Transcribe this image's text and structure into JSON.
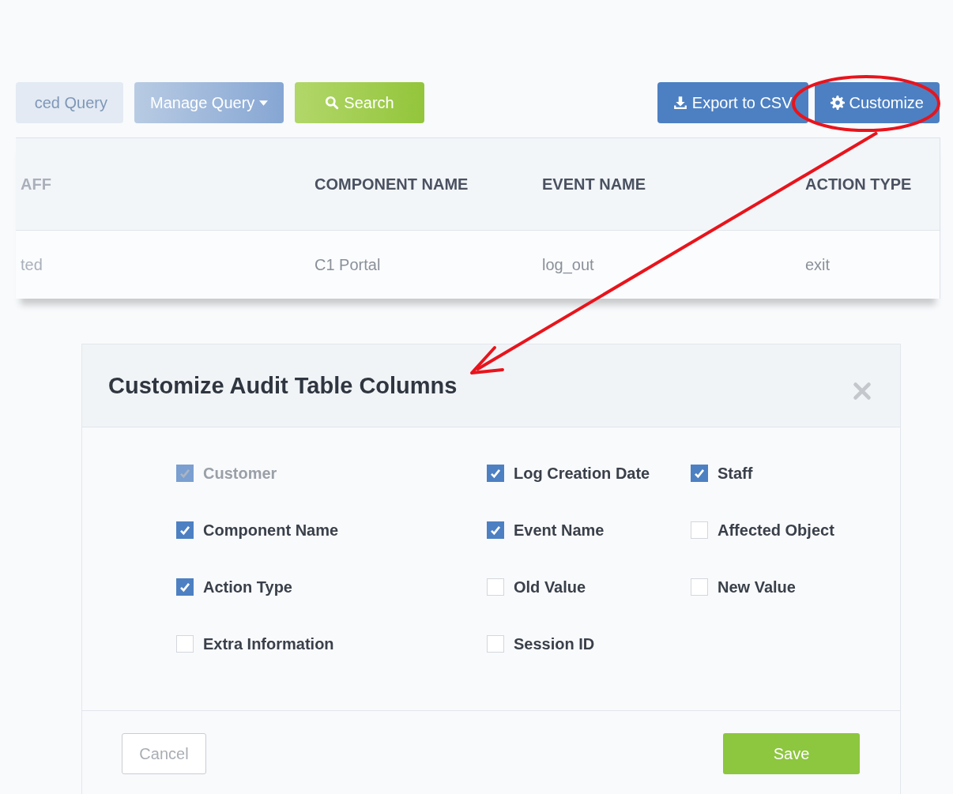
{
  "toolbar": {
    "left_buttons": [
      {
        "label": "ced Query",
        "kind": "faded"
      },
      {
        "label": "Manage Query",
        "kind": "dropdown"
      },
      {
        "label": "Search",
        "kind": "search"
      }
    ],
    "right_buttons": [
      {
        "label": "Export to CSV",
        "kind": "export"
      },
      {
        "label": "Customize",
        "kind": "settings"
      }
    ]
  },
  "table": {
    "columns": [
      "AFF",
      "COMPONENT NAME",
      "EVENT NAME",
      "ACTION TYPE"
    ],
    "rows": [
      [
        "ted",
        "C1 Portal",
        "log_out",
        "exit"
      ]
    ]
  },
  "modal": {
    "title": "Customize Audit Table Columns",
    "options": [
      {
        "label": "Customer",
        "checked": true,
        "disabled": true
      },
      {
        "label": "Log Creation Date",
        "checked": true,
        "disabled": false
      },
      {
        "label": "Staff",
        "checked": true,
        "disabled": false
      },
      {
        "label": "Component Name",
        "checked": true,
        "disabled": false
      },
      {
        "label": "Event Name",
        "checked": true,
        "disabled": false
      },
      {
        "label": "Affected Object",
        "checked": false,
        "disabled": false
      },
      {
        "label": "Action Type",
        "checked": true,
        "disabled": false
      },
      {
        "label": "Old Value",
        "checked": false,
        "disabled": false
      },
      {
        "label": "New Value",
        "checked": false,
        "disabled": false
      },
      {
        "label": "Extra Information",
        "checked": false,
        "disabled": false
      },
      {
        "label": "Session ID",
        "checked": false,
        "disabled": false
      }
    ],
    "buttons": [
      {
        "label": "Cancel",
        "kind": "secondary"
      },
      {
        "label": "Save",
        "kind": "primary"
      }
    ]
  }
}
